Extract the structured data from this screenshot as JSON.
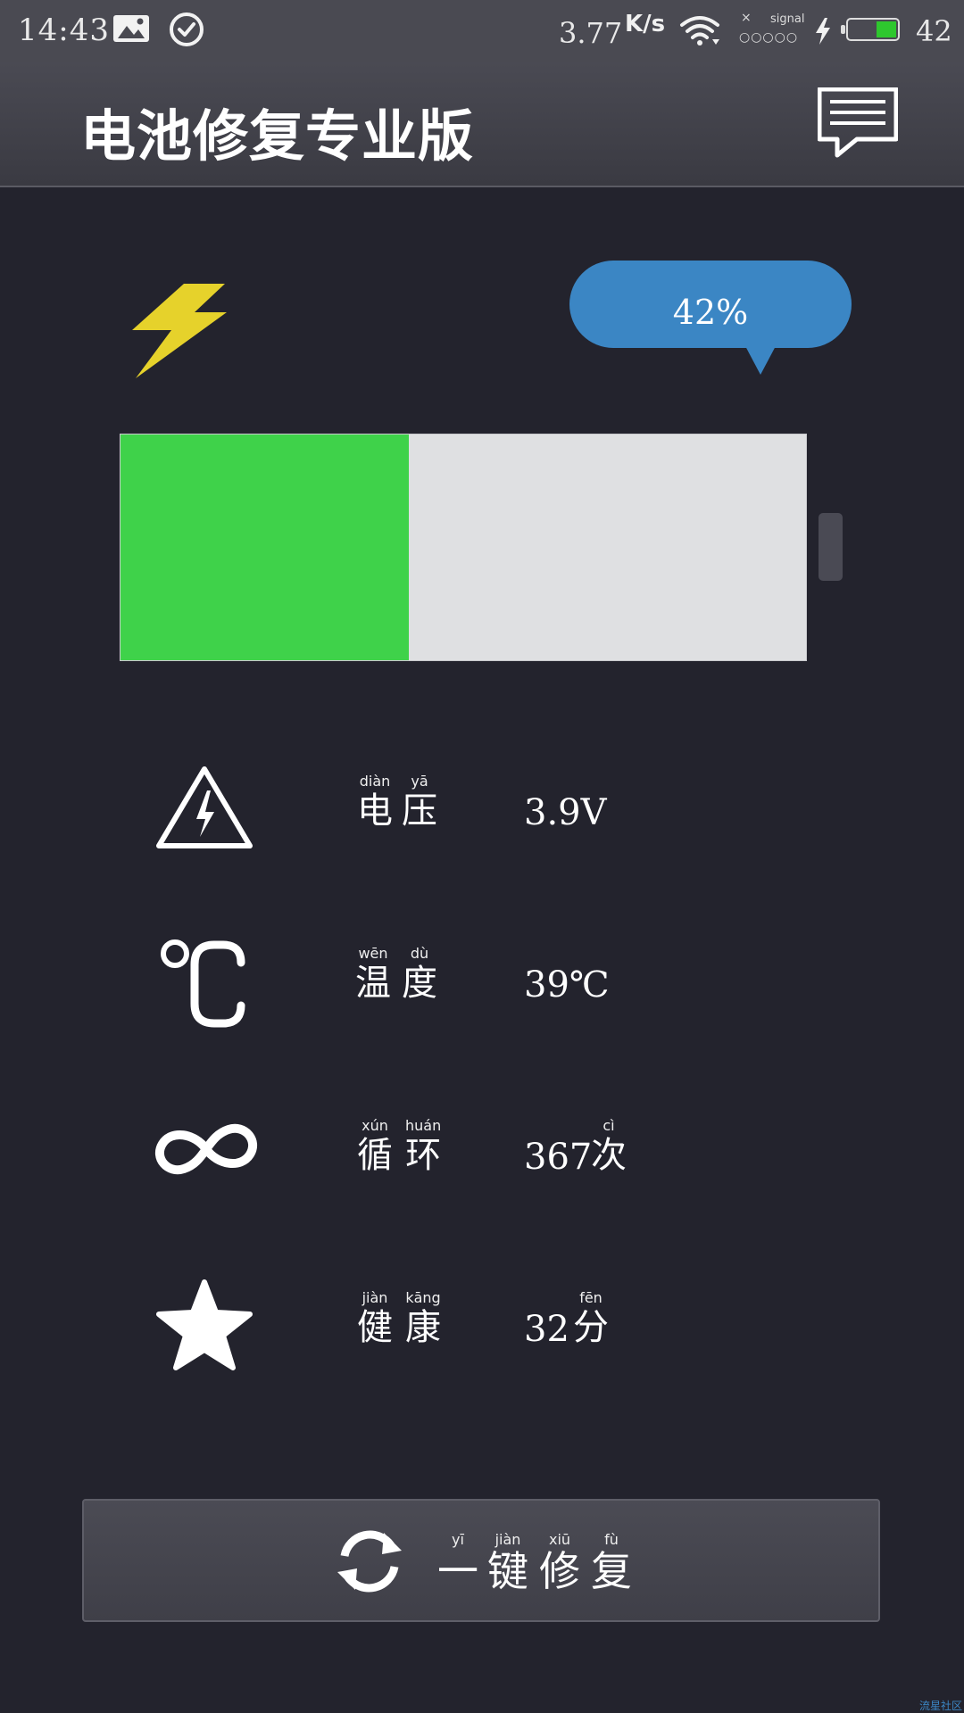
{
  "status_bar": {
    "time": "14:43",
    "net_speed": "3.77",
    "net_unit": "K/s",
    "signal_label": "signal",
    "signal_none": "×",
    "signal_dots": "○○○○○",
    "battery_level": "42",
    "battery_fraction": 0.42,
    "icons": [
      "image-icon",
      "check-circle-icon",
      "wifi-icon",
      "charging-bolt-icon",
      "battery-icon"
    ]
  },
  "header": {
    "title": "电池修复专业版",
    "message_icon": "message-icon"
  },
  "battery": {
    "percent_label": "42%",
    "level_fraction": 0.42,
    "charging_icon": "lightning-bolt-icon",
    "fill_color": "#3fd24a",
    "empty_color": "#dfe0e2"
  },
  "stats": [
    {
      "icon": "high-voltage-warning-icon",
      "label_chars": [
        "电",
        "压"
      ],
      "label_pinyin": [
        "diàn",
        "yā"
      ],
      "value": "3.9V"
    },
    {
      "icon": "celsius-icon",
      "label_chars": [
        "温",
        "度"
      ],
      "label_pinyin": [
        "wēn",
        "dù"
      ],
      "value": "39℃"
    },
    {
      "icon": "infinity-icon",
      "label_chars": [
        "循",
        "环"
      ],
      "label_pinyin": [
        "xún",
        "huán"
      ],
      "value": "367",
      "unit_char": "次",
      "unit_pinyin": "cì"
    },
    {
      "icon": "star-icon",
      "label_chars": [
        "健",
        "康"
      ],
      "label_pinyin": [
        "jiàn",
        "kāng"
      ],
      "value": "32",
      "unit_char": "分",
      "unit_pinyin": "fēn"
    }
  ],
  "repair_button": {
    "icon": "refresh-icon",
    "chars": [
      "一",
      "键",
      "修",
      "复"
    ],
    "pinyin": [
      "yī",
      "jiàn",
      "xiū",
      "fù"
    ]
  },
  "watermark": "流星社区"
}
